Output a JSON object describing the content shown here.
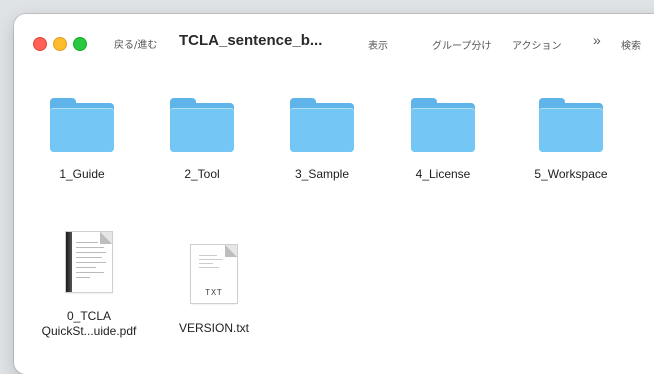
{
  "toolbar": {
    "nav_label": "戻る/進む",
    "title": "TCLA_sentence_b...",
    "view_label": "表示",
    "group_label": "グループ分け",
    "action_label": "アクション",
    "more_chevron": "»",
    "search_label": "検索"
  },
  "items": [
    {
      "name": "1_Guide",
      "icon": "folder-icon"
    },
    {
      "name": "2_Tool",
      "icon": "folder-icon"
    },
    {
      "name": "3_Sample",
      "icon": "folder-icon"
    },
    {
      "name": "4_License",
      "icon": "folder-icon"
    },
    {
      "name": "5_Workspace",
      "icon": "folder-icon"
    },
    {
      "name_line1": "0_TCLA",
      "name_line2": "QuickSt...uide.pdf",
      "icon": "pdf-document-icon"
    },
    {
      "name": "VERSION.txt",
      "icon": "text-document-icon",
      "badge": "TXT"
    }
  ],
  "colors": {
    "folder_front": "#74c6f5",
    "folder_back": "#5fb4ea",
    "close": "#ff5f57",
    "minimize": "#febc2e",
    "maximize": "#28c840"
  }
}
